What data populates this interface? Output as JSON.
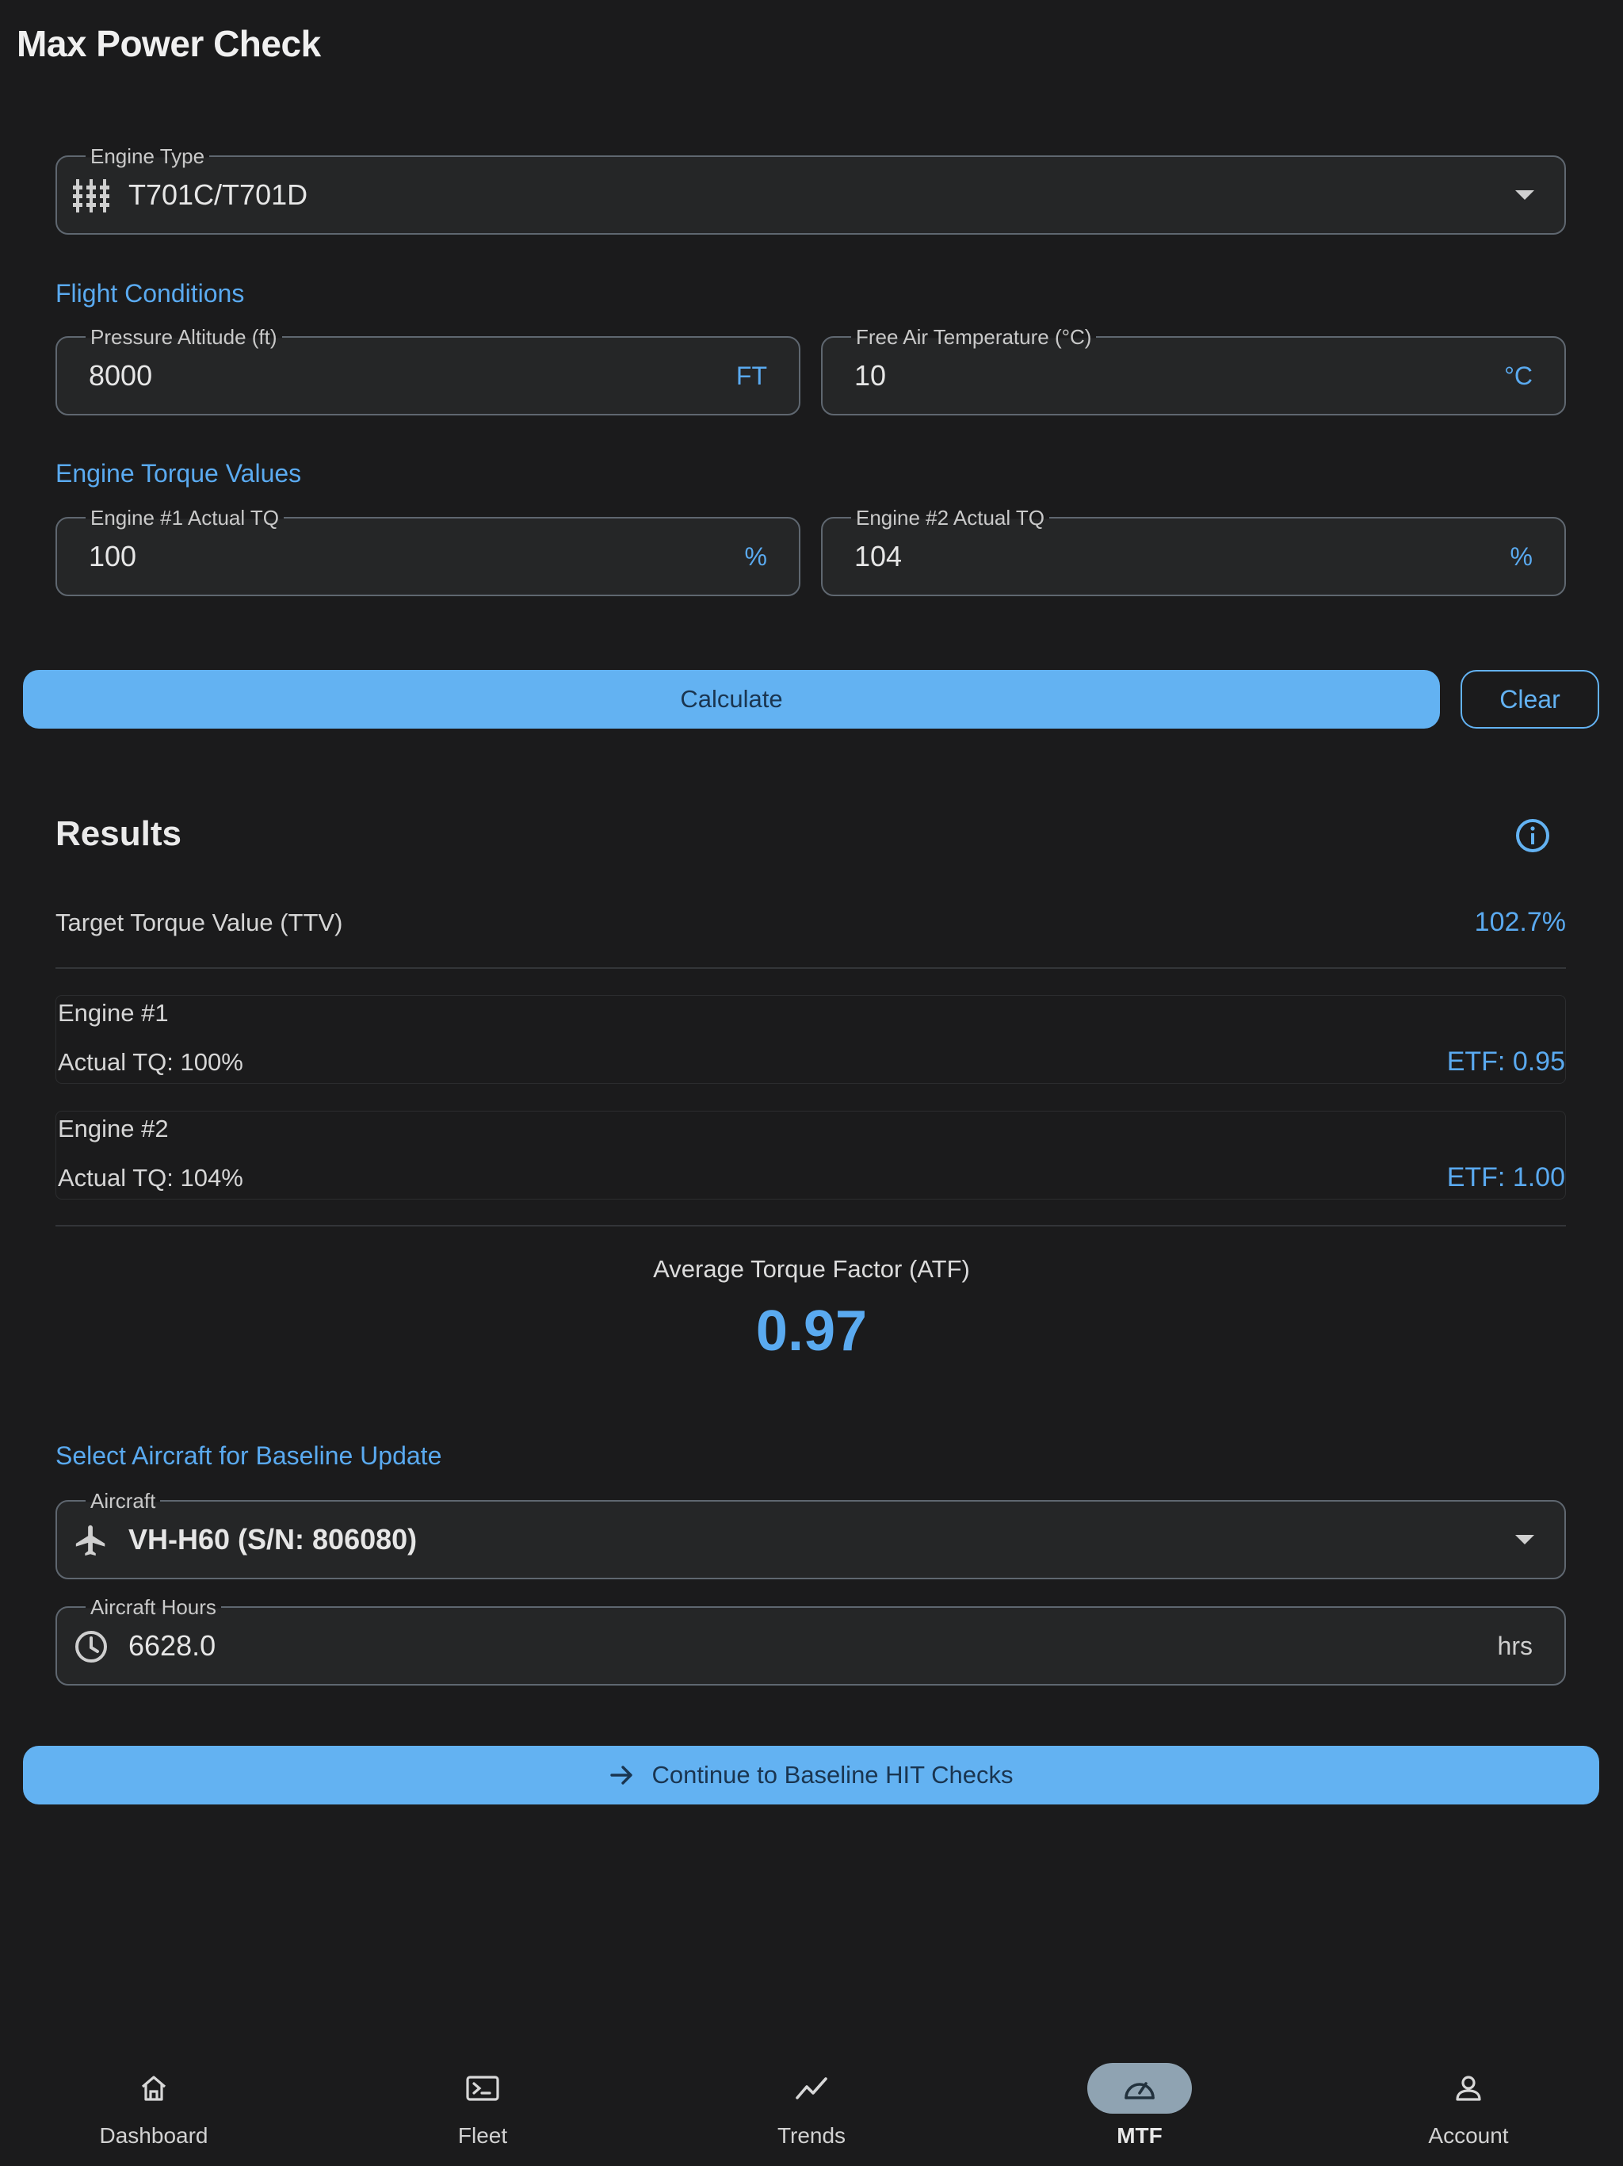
{
  "header": {
    "title": "Max Power Check"
  },
  "engine_type": {
    "label": "Engine Type",
    "value": "T701C/T701D",
    "icon": "engine-icon"
  },
  "flight_conditions": {
    "heading": "Flight Conditions",
    "pressure_altitude": {
      "label": "Pressure Altitude (ft)",
      "value": "8000",
      "suffix": "FT"
    },
    "free_air_temp": {
      "label": "Free Air Temperature (°C)",
      "value": "10",
      "suffix": "°C"
    }
  },
  "torque_values": {
    "heading": "Engine Torque Values",
    "engine1": {
      "label": "Engine #1 Actual TQ",
      "value": "100",
      "suffix": "%"
    },
    "engine2": {
      "label": "Engine #2 Actual TQ",
      "value": "104",
      "suffix": "%"
    }
  },
  "actions": {
    "calculate": "Calculate",
    "clear": "Clear"
  },
  "results": {
    "title": "Results",
    "ttv_label": "Target Torque Value (TTV)",
    "ttv_value": "102.7%",
    "engines": [
      {
        "title": "Engine #1",
        "actual": "Actual TQ: 100%",
        "etf": "ETF: 0.95"
      },
      {
        "title": "Engine #2",
        "actual": "Actual TQ: 104%",
        "etf": "ETF: 1.00"
      }
    ],
    "atf_label": "Average Torque Factor (ATF)",
    "atf_value": "0.97"
  },
  "baseline": {
    "heading": "Select Aircraft for Baseline Update",
    "aircraft": {
      "label": "Aircraft",
      "value": "VH-H60 (S/N: 806080)",
      "icon": "airplane-icon"
    },
    "hours": {
      "label": "Aircraft Hours",
      "value": "6628.0",
      "suffix": "hrs",
      "icon": "clock-icon"
    },
    "continue_label": "Continue to Baseline HIT Checks"
  },
  "nav": {
    "items": [
      {
        "label": "Dashboard",
        "icon": "home-icon"
      },
      {
        "label": "Fleet",
        "icon": "terminal-icon"
      },
      {
        "label": "Trends",
        "icon": "trend-icon"
      },
      {
        "label": "MTF",
        "icon": "gauge-icon",
        "active": true
      },
      {
        "label": "Account",
        "icon": "person-icon"
      }
    ]
  },
  "colors": {
    "accent": "#63b2f2",
    "background": "#1b1b1c",
    "field_bg": "#252627"
  }
}
